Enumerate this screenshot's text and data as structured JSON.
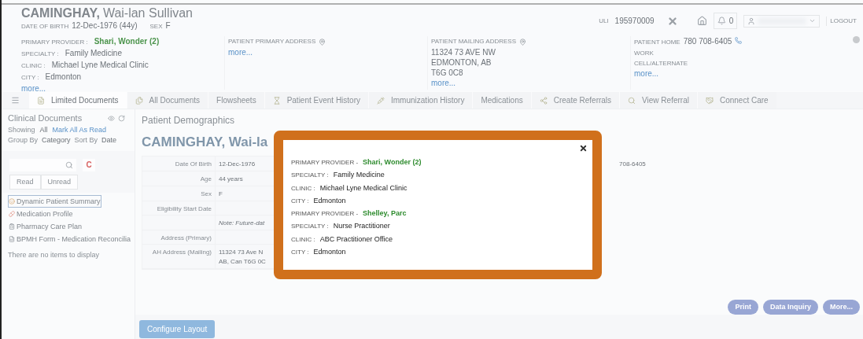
{
  "header": {
    "last_name": "CAMINGHAY,",
    "given_names": "Wai-lan Sullivan",
    "dob_label": "DATE OF BIRTH",
    "dob": "12-Dec-1976 (44y)",
    "sex_label": "SEX",
    "sex": "F",
    "uli_label": "ULI",
    "uli": "195970009",
    "notifications": "0",
    "logout": "LOGOUT",
    "columns": [
      {
        "rows": [
          {
            "kind": "provider",
            "label": "PRIMARY PROVIDER :",
            "value": "Shari, Wonder (2)"
          },
          {
            "kind": "field",
            "label": "SPECIALTY :",
            "value": "Family Medicine"
          },
          {
            "kind": "field",
            "label": "CLINIC :",
            "value": "Michael Lyne Medical Clinic"
          },
          {
            "kind": "field",
            "label": "CITY :",
            "value": "Edmonton"
          },
          {
            "kind": "link",
            "value": "more..."
          }
        ]
      },
      {
        "rows": [
          {
            "kind": "address_heading",
            "label": "PATIENT PRIMARY ADDRESS"
          },
          {
            "kind": "link",
            "value": "more..."
          }
        ]
      },
      {
        "rows": [
          {
            "kind": "address_heading",
            "label": "PATIENT MAILING ADDRESS"
          },
          {
            "kind": "text",
            "value": "11324 73 AVE NW"
          },
          {
            "kind": "text",
            "value": "EDMONTON, AB"
          },
          {
            "kind": "text",
            "value": "T6G 0C8"
          },
          {
            "kind": "link",
            "value": "more..."
          }
        ]
      },
      {
        "rows": [
          {
            "kind": "phone",
            "label": "PATIENT HOME",
            "value": "780 708-6405"
          },
          {
            "kind": "heading",
            "label": "WORK"
          },
          {
            "kind": "heading",
            "label": "CELL/ALTERNATE"
          },
          {
            "kind": "link",
            "value": "more..."
          }
        ]
      }
    ]
  },
  "tabs": [
    {
      "label": "Limited Documents",
      "selected": true
    },
    {
      "label": "All Documents",
      "selected": false
    },
    {
      "label": "Flowsheets",
      "selected": false
    },
    {
      "label": "Patient Event History",
      "selected": false
    },
    {
      "label": "Immunization History",
      "selected": false
    },
    {
      "label": "Medications",
      "selected": false
    },
    {
      "label": "Create Referrals",
      "selected": false
    },
    {
      "label": "View Referral",
      "selected": false
    },
    {
      "label": "Connect Care",
      "selected": false
    }
  ],
  "sidebar": {
    "title": "Clinical Documents",
    "showing_label": "Showing",
    "showing_value": "All",
    "mark_all": "Mark All As Read",
    "group_label": "Group By",
    "group_value": "Category",
    "sort_label": "Sort By",
    "sort_value": "Date",
    "clear": "C",
    "filters": [
      {
        "label": "Read",
        "selected": false
      },
      {
        "label": "Unread",
        "selected": false
      }
    ],
    "items": [
      {
        "label": "Dynamic Patient Summary",
        "selected": true
      },
      {
        "label": "Medication Profile",
        "selected": false
      },
      {
        "label": "Pharmacy Care Plan",
        "selected": false
      },
      {
        "label": "BPMH Form - Medication Reconcilia",
        "selected": false
      }
    ],
    "empty": "There are no items to display"
  },
  "main": {
    "section": "Patient Demographics",
    "title": "CAMINGHAY, Wai-la",
    "rows": [
      {
        "kind": "field",
        "label": "Date Of Birth",
        "value": [
          "12-Dec-1976"
        ]
      },
      {
        "kind": "field",
        "label": "Age",
        "value": [
          "44 years"
        ]
      },
      {
        "kind": "field",
        "label": "Sex",
        "value": [
          "F"
        ]
      },
      {
        "kind": "field",
        "label": "Eligibility Start Date",
        "value": []
      },
      {
        "kind": "note",
        "value": [
          "Note: Future-dat"
        ]
      },
      {
        "kind": "field",
        "label": "Address (Primary)",
        "value": []
      },
      {
        "kind": "field",
        "label": "AH Address (Mailing)",
        "value": [
          "11324 73 Ave N",
          "AB, Can T6G 0C"
        ]
      }
    ],
    "side_value": "708-6405",
    "actions": [
      "Print",
      "Data Inquiry",
      "More..."
    ],
    "configure": "Configure Layout"
  },
  "modal": {
    "rows": [
      {
        "kind": "provider",
        "label": "PRIMARY PROVIDER -",
        "value": "Shari, Wonder (2)"
      },
      {
        "kind": "field",
        "label": "SPECIALTY :",
        "value": "Family Medicine"
      },
      {
        "kind": "field",
        "label": "CLINIC :",
        "value": "Michael Lyne Medical Clinic"
      },
      {
        "kind": "field",
        "label": "CITY :",
        "value": "Edmonton"
      },
      {
        "kind": "provider",
        "label": "PRIMARY PROVIDER -",
        "value": "Shelley, Parc"
      },
      {
        "kind": "field",
        "label": "SPECIALTY :",
        "value": "Nurse Practitioner"
      },
      {
        "kind": "field",
        "label": "CLINIC :",
        "value": "ABC Practitioner Office"
      },
      {
        "kind": "field",
        "label": "CITY :",
        "value": "Edmonton"
      }
    ]
  }
}
